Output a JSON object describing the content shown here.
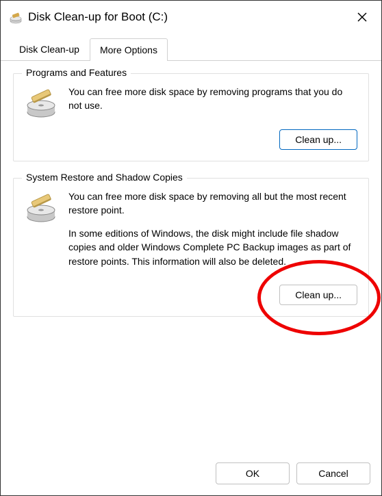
{
  "titlebar": {
    "title": "Disk Clean-up for Boot (C:)"
  },
  "tabs": {
    "cleanup": "Disk Clean-up",
    "more_options": "More Options"
  },
  "programs_section": {
    "title": "Programs and Features",
    "text": "You can free more disk space by removing programs that you do not use.",
    "button": "Clean up..."
  },
  "restore_section": {
    "title": "System Restore and Shadow Copies",
    "text1": "You can free more disk space by removing all but the most recent restore point.",
    "text2": "In some editions of Windows, the disk might include file shadow copies and older Windows Complete PC Backup images as part of restore points. This information will also be deleted.",
    "button": "Clean up..."
  },
  "footer": {
    "ok": "OK",
    "cancel": "Cancel"
  }
}
